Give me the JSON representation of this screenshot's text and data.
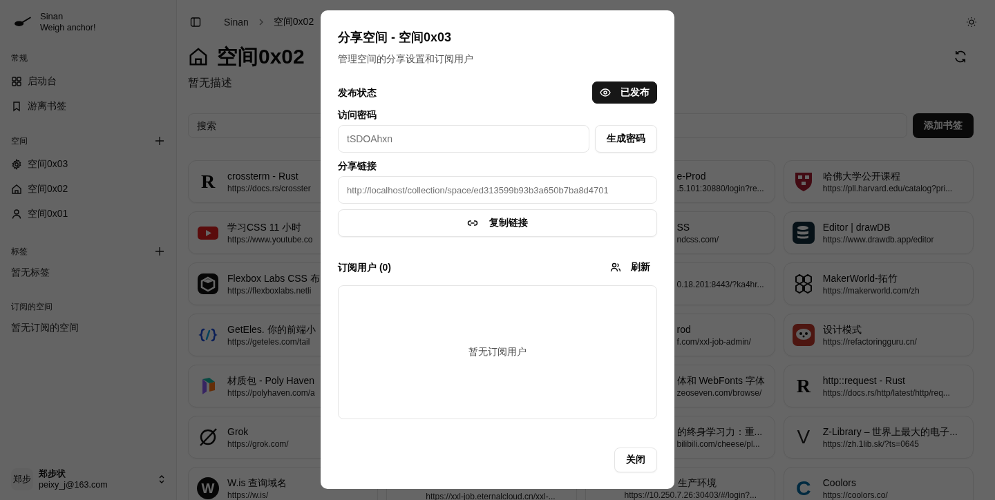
{
  "sidebar": {
    "brand": {
      "name": "Sinan",
      "tagline": "Weigh anchor!"
    },
    "sections": [
      {
        "label": "常规",
        "addable": false,
        "items": [
          {
            "label": "启动台",
            "kind": "grid"
          },
          {
            "label": "游离书签",
            "kind": "bookmark"
          }
        ]
      },
      {
        "label": "空间",
        "addable": true,
        "items": [
          {
            "label": "空间0x03",
            "kind": "gear"
          },
          {
            "label": "空间0x02",
            "kind": "home"
          },
          {
            "label": "空间0x01",
            "kind": "user"
          }
        ]
      },
      {
        "label": "标签",
        "addable": true,
        "empty": "暂无标签"
      },
      {
        "label": "订阅的空间",
        "addable": false,
        "empty": "暂无订阅的空间"
      }
    ],
    "user": {
      "avatar": "郑步",
      "name": "郑步状",
      "email": "peixy_j@163.com"
    }
  },
  "breadcrumb": [
    "Sinan",
    "空间0x02"
  ],
  "page": {
    "title": "空间0x02",
    "description": "暂无描述"
  },
  "search": {
    "placeholder": "搜索"
  },
  "add_button": "添加书签",
  "bookmark_columns": [
    [
      {
        "kind": "full",
        "icon": {
          "kind": "letter",
          "text": "R"
        },
        "title": "crossterm - Rust",
        "url": "https://docs.rs/crosster"
      },
      {
        "kind": "full",
        "icon": {
          "kind": "youtube"
        },
        "title": "学习CSS 11 小时",
        "url": "https://www.youtube.co"
      },
      {
        "kind": "full",
        "icon": {
          "kind": "cube"
        },
        "title": "Flexbox Labs CSS 布",
        "url": "https://flexboxlabs.netli"
      },
      {
        "kind": "full",
        "icon": {
          "kind": "code"
        },
        "title": "GetEles. 你的前端小",
        "url": "https://geteles.com/tail"
      },
      {
        "kind": "full",
        "icon": {
          "kind": "polygon"
        },
        "title": "材质包 - Poly Haven",
        "url": "https://polyhaven.com/a"
      },
      {
        "kind": "full",
        "icon": {
          "kind": "slash"
        },
        "title": "Grok",
        "url": "https://grok.com/"
      },
      {
        "kind": "full",
        "icon": {
          "kind": "letter-round",
          "text": "W"
        },
        "title": "W.is 查询域名",
        "url": "https://w.is/"
      }
    ],
    [
      {
        "kind": "url-only",
        "url": "https://xxl-job.eternalcloud.cn/xxl-..."
      }
    ],
    [
      {
        "kind": "right",
        "title": "e-Prod",
        "url": ".5.101:30880/login?re..."
      },
      {
        "kind": "right",
        "title": "SS",
        "url": "ndcss.com/"
      },
      {
        "kind": "right",
        "url": "0.18.201:8443/?ka4hr..."
      },
      {
        "kind": "right",
        "title": "rod",
        "url": "f.com/xxl-job-admin/"
      },
      {
        "kind": "right",
        "title": "体和 WebFonts 字体",
        "url": "zeoseven.com/browse/"
      },
      {
        "kind": "right",
        "title": "的终身学习力：重...",
        "url": "bilibili.com/cheese/pl..."
      },
      {
        "kind": "title-right",
        "title": "生产环境",
        "url": "https://10.250.7.26:30403/#/login?..."
      }
    ],
    [
      {
        "kind": "full",
        "icon": {
          "kind": "shield"
        },
        "title": "哈佛大学公开课程",
        "url": "https://pll.harvard.edu/catalog?pri..."
      },
      {
        "kind": "full",
        "icon": {
          "kind": "database"
        },
        "title": "Editor | drawDB",
        "url": "https://www.drawdb.app/editor"
      },
      {
        "kind": "full",
        "icon": {
          "kind": "cubes"
        },
        "title": "MakerWorld-拓竹",
        "url": "https://makerworld.com/zh"
      },
      {
        "kind": "full",
        "icon": {
          "kind": "mascot"
        },
        "title": "设计模式",
        "url": "https://refactoringguru.cn/"
      },
      {
        "kind": "full",
        "icon": {
          "kind": "letter",
          "text": "R"
        },
        "title": "http::request - Rust",
        "url": "https://docs.rs/http/latest/http/req..."
      },
      {
        "kind": "full",
        "icon": {
          "kind": "letter-thin",
          "text": "V"
        },
        "title": "Z-Library – 世界上最大的电子...",
        "url": "https://zh.1lib.sk/?ts=0645"
      },
      {
        "kind": "full",
        "icon": {
          "kind": "letter-blue",
          "text": "C"
        },
        "title": "Coolors",
        "url": "https://coolors.co/"
      }
    ]
  ],
  "dialog": {
    "title": "分享空间 - 空间0x03",
    "description": "管理空间的分享设置和订阅用户",
    "publish": {
      "label": "发布状态",
      "button": "已发布",
      "published": true
    },
    "password": {
      "label": "访问密码",
      "value": "tSDOAhxn",
      "button": "生成密码"
    },
    "link": {
      "label": "分享链接",
      "value": "http://localhost/collection/space/ed313599b93b3a650b7ba8d4701",
      "button": "复制链接"
    },
    "subscribers": {
      "label": "订阅用户 (0)",
      "refresh": "刷新",
      "empty": "暂无订阅用户"
    },
    "close": "关闭"
  }
}
